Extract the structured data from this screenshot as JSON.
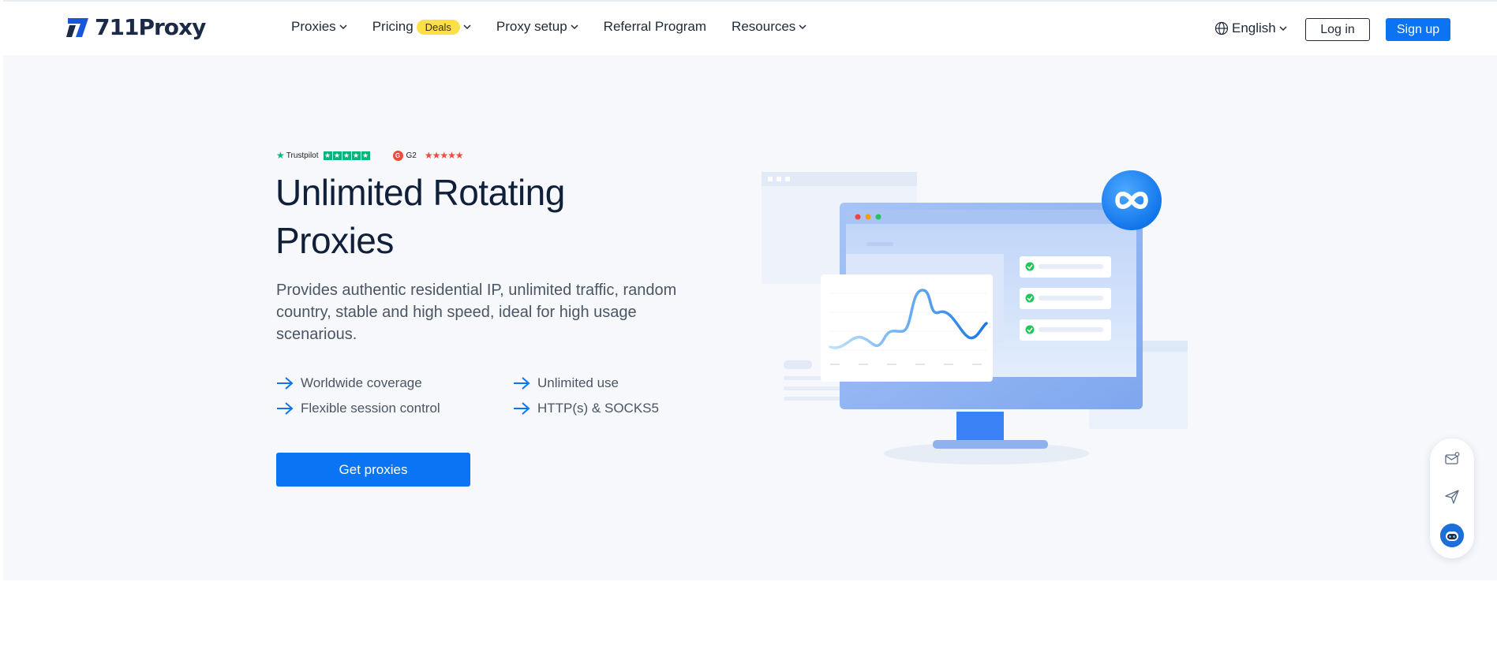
{
  "header": {
    "brand": "711Proxy",
    "brand_parts": {
      "num": "711",
      "name": "Proxy"
    },
    "nav": [
      {
        "label": "Proxies",
        "has_dropdown": true
      },
      {
        "label": "Pricing",
        "badge": "Deals",
        "has_dropdown": true
      },
      {
        "label": "Proxy setup",
        "has_dropdown": true
      },
      {
        "label": "Referral Program",
        "has_dropdown": false
      },
      {
        "label": "Resources",
        "has_dropdown": true
      }
    ],
    "language": "English",
    "login_label": "Log in",
    "signup_label": "Sign up"
  },
  "hero": {
    "ratings": {
      "trustpilot": "Trustpilot",
      "g2": "G2",
      "g2_logo": "G"
    },
    "title": "Unlimited Rotating Proxies",
    "description": "Provides authentic residential IP, unlimited traffic, random country, stable and high speed, ideal for high usage scenarious.",
    "features": [
      "Worldwide coverage",
      "Unlimited use",
      "Flexible session control",
      "HTTP(s) & SOCKS5"
    ],
    "cta_label": "Get proxies"
  },
  "icons": {
    "logo": "711proxy-logo-icon",
    "language": "globe-icon",
    "feature_bullet": "arrow-right-icon",
    "float": [
      "mail-icon",
      "send-icon",
      "support-avatar-icon"
    ]
  },
  "colors": {
    "accent": "#0b74f5",
    "deals_badge": "#fde047",
    "trustpilot": "#00b67a",
    "g2": "#ef4a3a",
    "hero_bg": "#f6f8fb"
  }
}
